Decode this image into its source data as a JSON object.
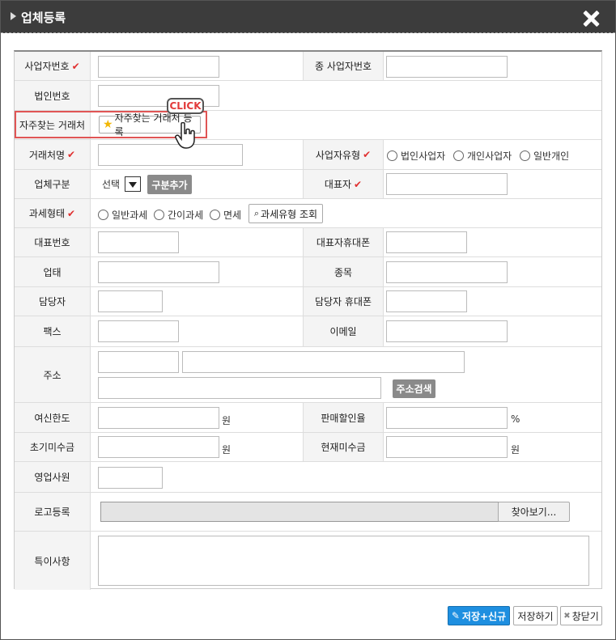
{
  "window": {
    "title": "업체등록"
  },
  "rows": {
    "biz_no": {
      "label": "사업자번호",
      "label2": "종 사업자번호"
    },
    "corp_no": {
      "label": "법인번호"
    },
    "fav": {
      "label": "자주찾는 거래처",
      "button": "자주찾는 거래처 등록",
      "callout": "CLICK"
    },
    "client_name": {
      "label": "거래처명",
      "label2": "사업자유형",
      "options": [
        "법인사업자",
        "개인사업자",
        "일반개인"
      ]
    },
    "category": {
      "label": "업체구분",
      "select_value": "선택",
      "button": "구분추가",
      "label2": "대표자"
    },
    "tax": {
      "label": "과세형태",
      "options": [
        "일반과세",
        "간이과세",
        "면세"
      ],
      "button": "과세유형 조회"
    },
    "rep_phone": {
      "label": "대표번호",
      "label2": "대표자휴대폰"
    },
    "business": {
      "label": "업태",
      "label2": "종목"
    },
    "manager": {
      "label": "담당자",
      "label2": "담당자 휴대폰"
    },
    "fax": {
      "label": "팩스",
      "label2": "이메일"
    },
    "address": {
      "label": "주소",
      "button": "주소검색"
    },
    "credit": {
      "label": "여신한도",
      "unit": "원",
      "label2": "판매할인율",
      "unit2": "%"
    },
    "initial": {
      "label": "초기미수금",
      "unit": "원",
      "label2": "현재미수금",
      "unit2": "원"
    },
    "sales": {
      "label": "영업사원"
    },
    "logo": {
      "label": "로고등록",
      "button": "찾아보기..."
    },
    "notes": {
      "label": "특이사항"
    }
  },
  "footer": {
    "save_new": "저장+신규",
    "save": "저장하기",
    "close": "창닫기"
  },
  "colors": {
    "titlebar": "#3c3c3c",
    "required_check": "#e03030",
    "primary_button": "#1e8fe0",
    "highlight": "#e05555"
  }
}
